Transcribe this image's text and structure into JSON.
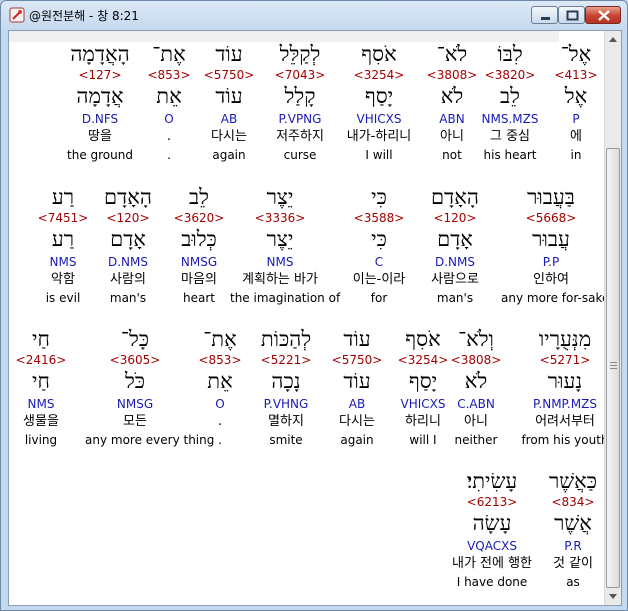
{
  "window": {
    "title": "@원전분해 - 창 8:21"
  },
  "rows": [
    [
      {
        "heb": "אֶל־",
        "strong": "<413>",
        "root": "אֶל",
        "parse": "P",
        "kor": "에",
        "eng": "in"
      },
      {
        "heb": "לִבּוֹ",
        "strong": "<3820>",
        "root": "לֵב",
        "parse": "NMS.MZS",
        "kor": "그 중심",
        "eng": "his heart"
      },
      {
        "heb": "לֹא־",
        "strong": "<3808>",
        "root": "לֹא",
        "parse": "ABN",
        "kor": "아니",
        "eng": "not"
      },
      {
        "heb": "אֹסִף",
        "strong": "<3254>",
        "root": "יָסַף",
        "parse": "VHICXS",
        "kor": "내가-하리니",
        "eng": "I will"
      },
      {
        "heb": "לְקַלֵּל",
        "strong": "<7043>",
        "root": "קָלַל",
        "parse": "P.VPNG",
        "kor": "저주하지",
        "eng": "curse"
      },
      {
        "heb": "עוֹד",
        "strong": "<5750>",
        "root": "עוֹד",
        "parse": "AB",
        "kor": "다시는",
        "eng": "again"
      },
      {
        "heb": "אֶת־",
        "strong": "<853>",
        "root": "אֵת",
        "parse": "O",
        "kor": ".",
        "eng": "."
      },
      {
        "heb": "הָאֲדָמָה",
        "strong": "<127>",
        "root": "אֲדָמָה",
        "parse": "D.NFS",
        "kor": "땅을",
        "eng": "the ground"
      }
    ],
    [
      {
        "heb": "בַּעֲבוּר",
        "strong": "<5668>",
        "root": "עֲבוּר",
        "parse": "P.P",
        "kor": "인하여",
        "eng": "any more for-sake"
      },
      {
        "heb": "הָאָדָם",
        "strong": "<120>",
        "root": "אָדָם",
        "parse": "D.NMS",
        "kor": "사람으로",
        "eng": "man's"
      },
      {
        "heb": "כִּי",
        "strong": "<3588>",
        "root": "כִּי",
        "parse": "C",
        "kor": "이는-이라",
        "eng": "for"
      },
      {
        "heb": "יֵצֶר",
        "strong": "<3336>",
        "root": "יֵצֶר",
        "parse": "NMS",
        "kor": "계획하는 바가",
        "eng": "the imagination of"
      },
      {
        "heb": "לֵב",
        "strong": "<3620>",
        "root": "כְּלוּב",
        "parse": "NMSG",
        "kor": "마음의",
        "eng": "heart"
      },
      {
        "heb": "הָאָדָם",
        "strong": "<120>",
        "root": "אָדָם",
        "parse": "D.NMS",
        "kor": "사람의",
        "eng": "man's"
      },
      {
        "heb": "רַע",
        "strong": "<7451>",
        "root": "רַע",
        "parse": "NMS",
        "kor": "악함",
        "eng": "is evil"
      }
    ],
    [
      {
        "heb": "מִנְּעֻרָיו",
        "strong": "<5271>",
        "root": "נָעוּר",
        "parse": "P.NMP.MZS",
        "kor": "어려서부터",
        "eng": "from his youth"
      },
      {
        "heb": "וְלֹא־",
        "strong": "<3808>",
        "root": "לֹא",
        "parse": "C.ABN",
        "kor": "아니",
        "eng": "neither"
      },
      {
        "heb": "אֹסִף",
        "strong": "<3254>",
        "root": "יָסַף",
        "parse": "VHICXS",
        "kor": "하리니",
        "eng": "will I"
      },
      {
        "heb": "עוֹד",
        "strong": "<5750>",
        "root": "עוֹד",
        "parse": "AB",
        "kor": "다시는",
        "eng": "again"
      },
      {
        "heb": "לְהַכּוֹת",
        "strong": "<5221>",
        "root": "נָכָה",
        "parse": "P.VHNG",
        "kor": "멸하지",
        "eng": "smite"
      },
      {
        "heb": "אֶת־",
        "strong": "<853>",
        "root": "אֵת",
        "parse": "O",
        "kor": ".",
        "eng": "."
      },
      {
        "heb": "כָּל־",
        "strong": "<3605>",
        "root": "כֹּל",
        "parse": "NMSG",
        "kor": "모든",
        "eng": "any more every thing"
      },
      {
        "heb": "חַי",
        "strong": "<2416>",
        "root": "חַי",
        "parse": "NMS",
        "kor": "생물을",
        "eng": "living"
      }
    ],
    [
      {
        "heb": "כַּאֲשֶׁר",
        "strong": "<834>",
        "root": "אֲשֶׁר",
        "parse": "P.R",
        "kor": "것 같이",
        "eng": "as"
      },
      {
        "heb": "עָשִׂיתִי׃",
        "strong": "<6213>",
        "root": "עָשָׂה",
        "parse": "VQACXS",
        "kor": "내가 전에 행한",
        "eng": "I have done"
      }
    ]
  ]
}
